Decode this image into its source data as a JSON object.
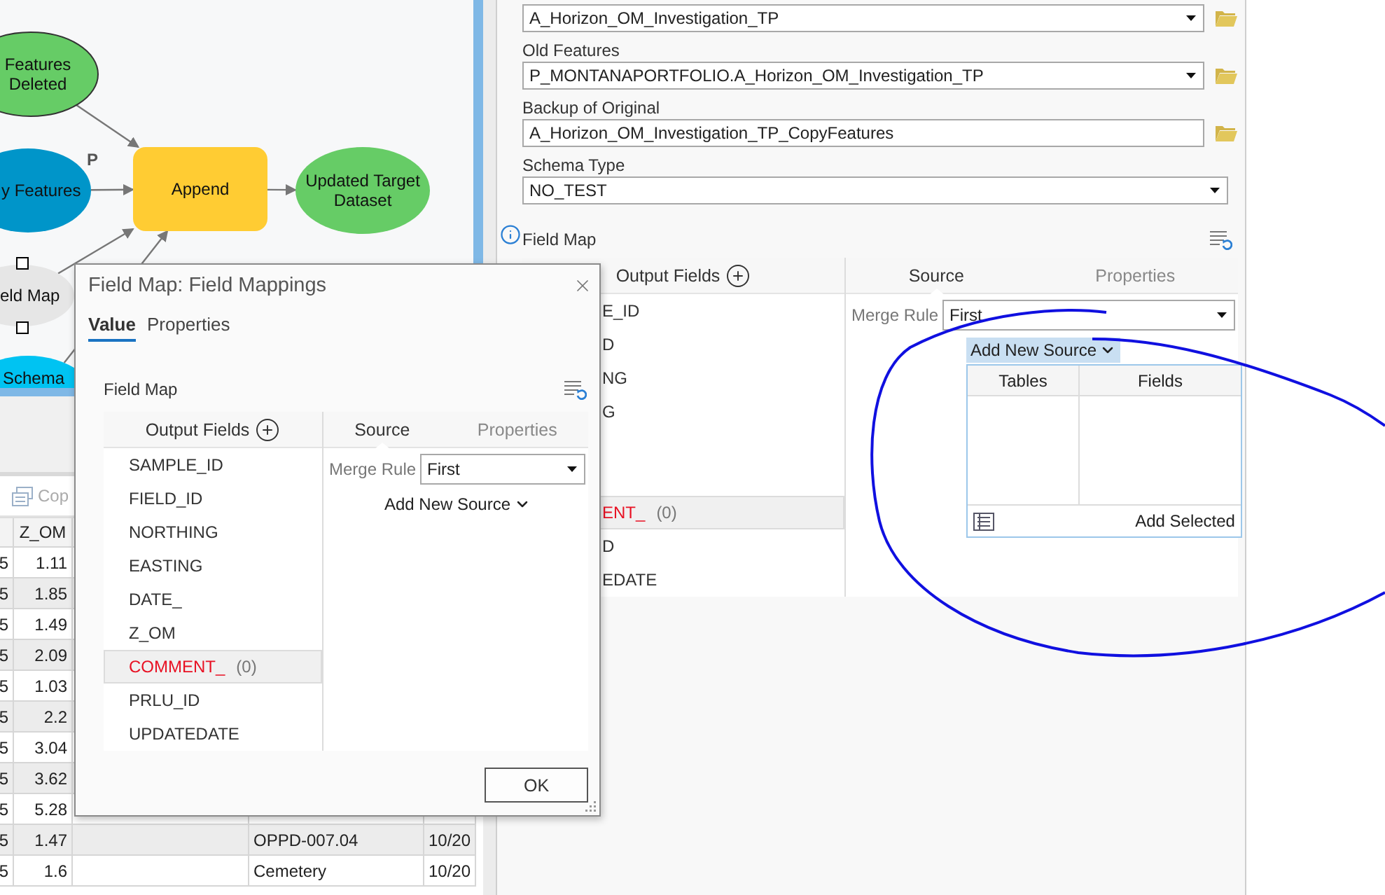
{
  "model": {
    "nodes": [
      {
        "kind": "data",
        "lines": [
          "Features",
          "Deleted"
        ],
        "color": "#66cc66",
        "selected": false
      },
      {
        "kind": "data",
        "lines": [
          "y Features"
        ],
        "color": "#0095c9",
        "selected": false,
        "parameter": "P"
      },
      {
        "kind": "tool",
        "lines": [
          "Append"
        ],
        "color": "#ffcc33",
        "selected": false
      },
      {
        "kind": "data",
        "lines": [
          "Updated Target",
          "Dataset"
        ],
        "color": "#66cc66",
        "selected": false
      },
      {
        "kind": "data",
        "lines": [
          "eld Map"
        ],
        "color": "#e6e6e6",
        "selected": true
      },
      {
        "kind": "data",
        "lines": [
          "Schema"
        ],
        "color": "#00c3f2",
        "selected": false
      }
    ]
  },
  "table": {
    "toolbar_button": {
      "label": "Cop",
      "disabled": true
    },
    "z_om_heading": "Z_OM",
    "rows": [
      {
        "column_1": "5",
        "z_om": "1.11"
      },
      {
        "column_1": "5",
        "z_om": "1.85"
      },
      {
        "column_1": "5",
        "z_om": "1.49"
      },
      {
        "column_1": "5",
        "z_om": "2.09"
      },
      {
        "column_1": "5",
        "z_om": "1.03"
      },
      {
        "column_1": "5",
        "z_om": "2.2"
      },
      {
        "column_1": "5",
        "z_om": "3.04"
      },
      {
        "column_1": "5",
        "z_om": "3.62"
      },
      {
        "column_1": "5",
        "z_om": "5.28"
      },
      {
        "column_1": "5",
        "z_om": "1.47",
        "column_4": "OPPD-007.04",
        "column_5": "10/20"
      },
      {
        "column_1": "5",
        "z_om": "1.6",
        "column_4": "Cemetery",
        "column_5": "10/20"
      }
    ]
  },
  "tool_panel": {
    "fields": [
      {
        "kind": "dropdown",
        "value": "A_Horizon_OM_Investigation_TP",
        "browse": true
      },
      {
        "kind": "dropdown",
        "label": "Old Features",
        "value": "P_MONTANAPORTFOLIO.A_Horizon_OM_Investigation_TP",
        "browse": true
      },
      {
        "kind": "text",
        "label": "Backup of Original",
        "value": "A_Horizon_OM_Investigation_TP_CopyFeatures",
        "browse": true
      },
      {
        "kind": "dropdown",
        "label": "Schema Type",
        "value": "NO_TEST",
        "browse": false
      }
    ],
    "field_map": {
      "label": "Field Map",
      "info": true,
      "output_fields_heading": "Output Fields",
      "tabs": [
        {
          "label": "Source",
          "selected": true
        },
        {
          "label": "Properties",
          "selected": false
        }
      ],
      "items": [
        {
          "text": "E_ID",
          "selected": false
        },
        {
          "text": "D",
          "selected": false
        },
        {
          "text": "NG",
          "selected": false
        },
        {
          "text": "G",
          "selected": false
        },
        {
          "selected": false
        },
        {
          "selected": false
        },
        {
          "text": "ENT_",
          "count": "(0)",
          "selected": true,
          "error": true
        },
        {
          "text": "D",
          "selected": false
        },
        {
          "text": "EDATE",
          "selected": false
        }
      ],
      "merge_rule_label": "Merge Rule",
      "merge_rule": "First",
      "add_source": {
        "label": "Add New Source",
        "expanded": true,
        "columns": [
          "Tables",
          "Fields"
        ],
        "button": "Add Selected"
      }
    }
  },
  "dialog": {
    "title": "Field Map: Field Mappings",
    "tabs": [
      {
        "label": "Value",
        "selected": true
      },
      {
        "label": "Properties",
        "selected": false
      }
    ],
    "field_map": {
      "label": "Field Map",
      "output_fields_heading": "Output Fields",
      "tabs": [
        {
          "label": "Source",
          "selected": true
        },
        {
          "label": "Properties",
          "selected": false
        }
      ],
      "items": [
        {
          "text": "SAMPLE_ID",
          "selected": false
        },
        {
          "text": "FIELD_ID",
          "selected": false
        },
        {
          "text": "NORTHING",
          "selected": false
        },
        {
          "text": "EASTING",
          "selected": false
        },
        {
          "text": "DATE_",
          "selected": false
        },
        {
          "text": "Z_OM",
          "selected": false
        },
        {
          "text": "COMMENT_",
          "count": "(0)",
          "selected": true,
          "error": true
        },
        {
          "text": "PRLU_ID",
          "selected": false
        },
        {
          "text": "UPDATEDATE",
          "selected": false
        }
      ],
      "merge_rule_label": "Merge Rule",
      "merge_rule": "First",
      "add_source": {
        "label": "Add New Source",
        "expanded": false
      }
    },
    "ok_button": "OK"
  }
}
